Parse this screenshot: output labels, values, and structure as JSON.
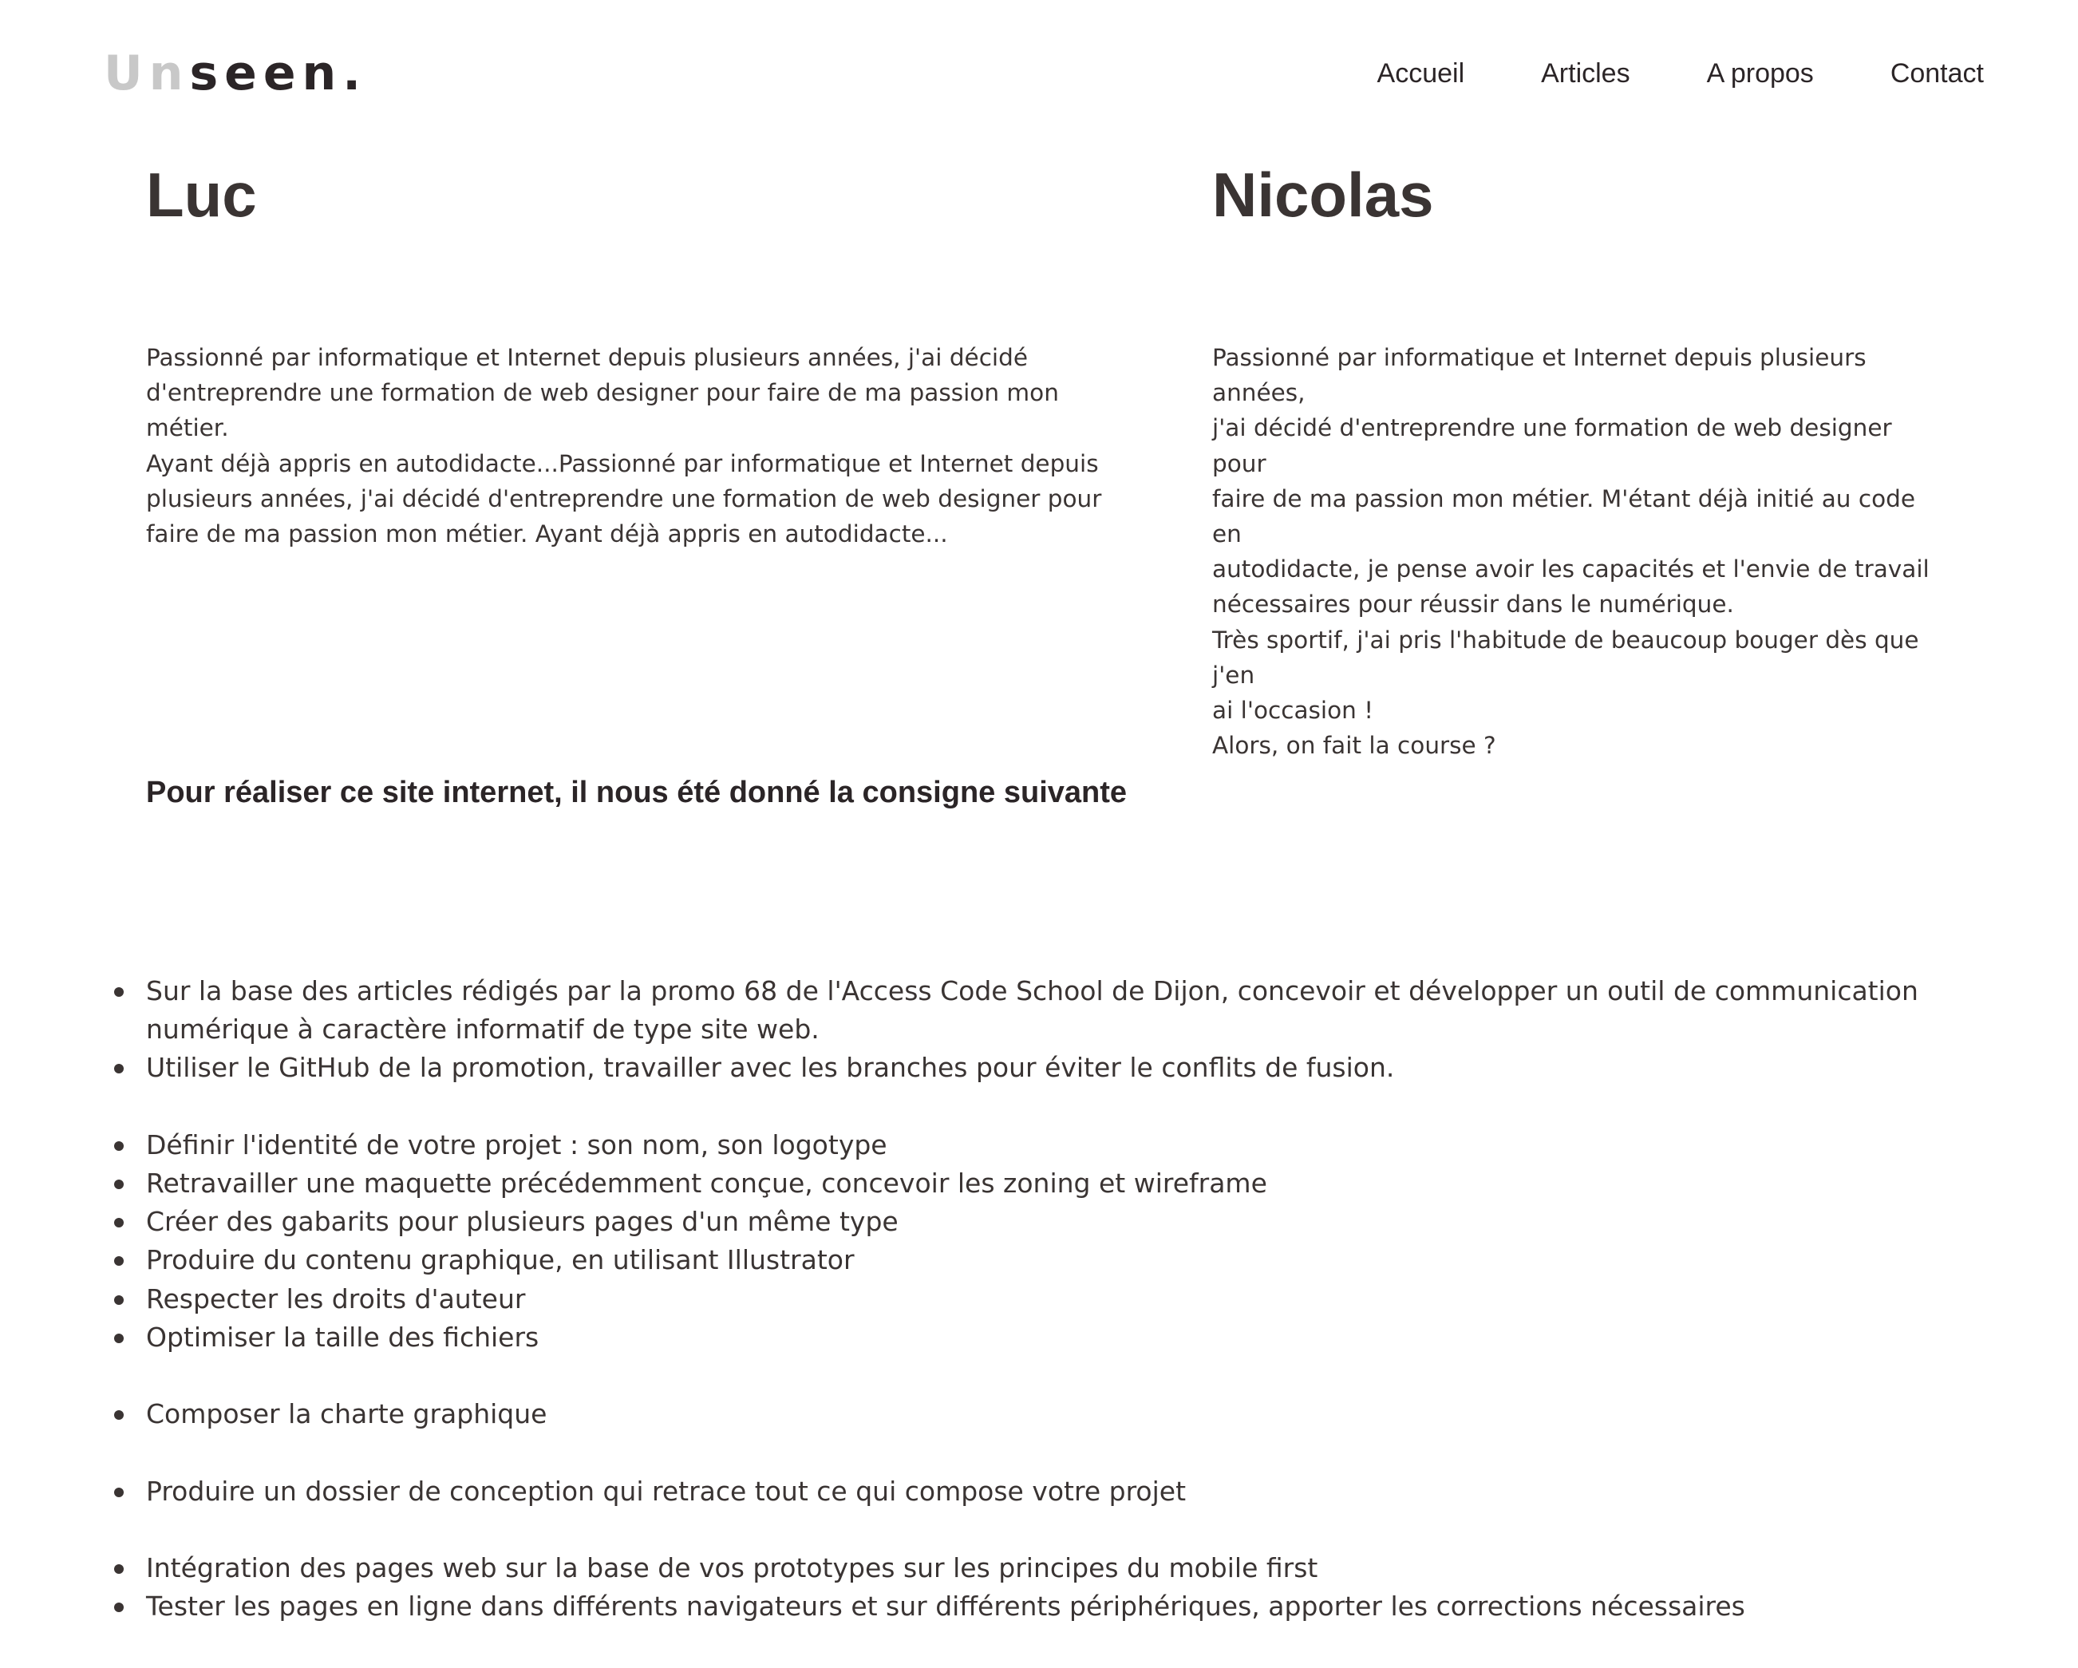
{
  "header": {
    "logo_light": "Un",
    "logo_dark": "seen.",
    "nav": [
      "Accueil",
      "Articles",
      "A propos",
      "Contact"
    ]
  },
  "people": [
    {
      "name": "Luc",
      "bio": "Passionné par informatique et Internet depuis plusieurs années, j'ai décidé\nd'entreprendre une formation de web designer pour faire de ma passion mon métier.\nAyant déjà appris en autodidacte...Passionné par informatique et Internet depuis\nplusieurs années, j'ai décidé d'entreprendre une formation de web designer pour\nfaire de ma passion mon métier. Ayant déjà appris en autodidacte..."
    },
    {
      "name": "Nicolas",
      "bio": "Passionné par informatique et Internet depuis plusieurs années,\nj'ai décidé d'entreprendre une formation de web designer pour\nfaire de ma passion mon métier. M'étant déjà initié au code en\nautodidacte, je pense avoir les capacités et l'envie de travail\nnécessaires pour réussir dans le numérique.\nTrès sportif, j'ai pris l'habitude de beaucoup bouger dès que j'en\nai l'occasion !\nAlors, on fait la course ?"
    }
  ],
  "consigne_title": "Pour réaliser ce site internet, il nous été donné la consigne suivante",
  "tasks": [
    "Sur la base des articles rédigés par la promo 68 de l'Access Code School de Dijon, concevoir et développer un outil de communication numérique à caractère informatif de type site web.",
    "Utiliser le GitHub de la promotion, travailler avec les branches pour éviter le conflits de fusion.",
    "Définir l'identité de votre projet : son nom, son logotype",
    "Retravailler une maquette précédemment conçue, concevoir les zoning et wireframe",
    "Créer des gabarits pour plusieurs pages d'un même type",
    "Produire du contenu graphique, en utilisant Illustrator",
    "Respecter les droits d'auteur",
    "Optimiser la taille des fichiers",
    "Composer la charte graphique",
    "Produire un dossier de conception qui retrace tout ce qui compose votre projet",
    "Intégration des pages web sur la base de vos prototypes sur les principes du mobile first",
    "Tester les pages en ligne dans différents navigateurs et sur différents périphériques, apporter les corrections nécessaires"
  ]
}
